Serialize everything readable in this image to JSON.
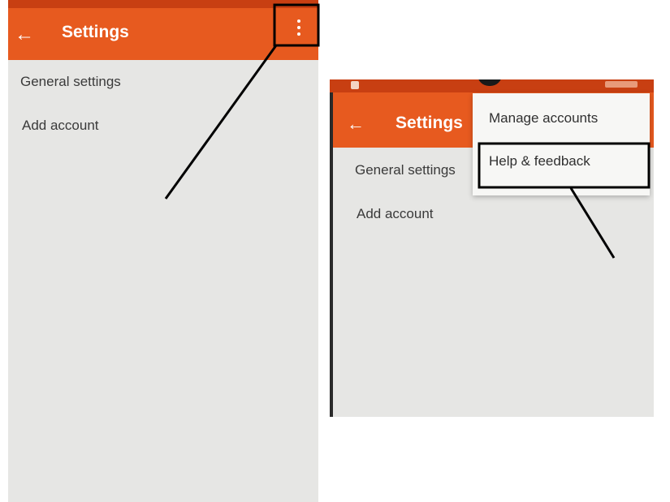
{
  "left_screen": {
    "title": "Settings",
    "back_icon": "arrow-left-icon",
    "overflow_icon": "more-vert-icon",
    "items": [
      {
        "label": "General settings"
      },
      {
        "label": "Add account"
      }
    ]
  },
  "right_screen": {
    "title": "Settings",
    "back_icon": "arrow-left-icon",
    "items": [
      {
        "label": "General settings"
      },
      {
        "label": "Add account"
      }
    ],
    "menu": {
      "items": [
        {
          "label": "Manage accounts"
        },
        {
          "label": "Help & feedback"
        }
      ]
    }
  },
  "colors": {
    "appbar": "#e75a1f",
    "statusbar": "#c83f12",
    "background": "#e6e6e4",
    "annotation": "#000000"
  }
}
